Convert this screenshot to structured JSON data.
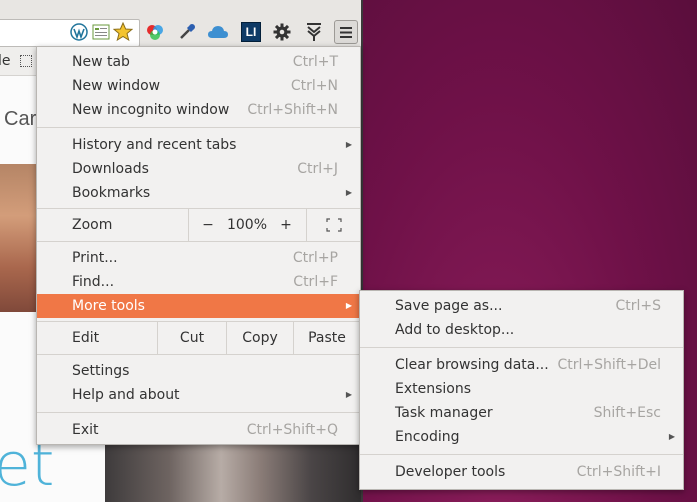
{
  "colors": {
    "menu_highlight": "#f07746",
    "desktop": "#6f1148",
    "shortcut_text": "#a7a5a2"
  },
  "toolbar": {
    "icons": [
      "wordpress-icon",
      "feed-icon",
      "bookmark-star-icon",
      "color-wheel-icon",
      "eyedropper-icon",
      "cloud-icon",
      "linkedin-icon",
      "gear-icon",
      "download-arrows-icon"
    ],
    "linkedin_text": "LI",
    "menu_button": "hamburger-menu-icon"
  },
  "page": {
    "bookmark_fragment": "le",
    "heading_fragment": "Car",
    "large_fragment": "et"
  },
  "main_menu": {
    "new_tab": {
      "label": "New tab",
      "shortcut": "Ctrl+T"
    },
    "new_window": {
      "label": "New window",
      "shortcut": "Ctrl+N"
    },
    "new_incognito": {
      "label": "New incognito window",
      "shortcut": "Ctrl+Shift+N"
    },
    "history": {
      "label": "History and recent tabs"
    },
    "downloads": {
      "label": "Downloads",
      "shortcut": "Ctrl+J"
    },
    "bookmarks": {
      "label": "Bookmarks"
    },
    "zoom": {
      "label": "Zoom",
      "minus": "−",
      "value": "100%",
      "plus": "+"
    },
    "print": {
      "label": "Print...",
      "shortcut": "Ctrl+P"
    },
    "find": {
      "label": "Find...",
      "shortcut": "Ctrl+F"
    },
    "more_tools": {
      "label": "More tools"
    },
    "edit": {
      "label": "Edit",
      "cut": "Cut",
      "copy": "Copy",
      "paste": "Paste"
    },
    "settings": {
      "label": "Settings"
    },
    "help": {
      "label": "Help and about"
    },
    "exit": {
      "label": "Exit",
      "shortcut": "Ctrl+Shift+Q"
    }
  },
  "sub_menu": {
    "save_page": {
      "label": "Save page as...",
      "shortcut": "Ctrl+S"
    },
    "add_desktop": {
      "label": "Add to desktop..."
    },
    "clear_data": {
      "label": "Clear browsing data...",
      "shortcut": "Ctrl+Shift+Del"
    },
    "extensions": {
      "label": "Extensions"
    },
    "task_manager": {
      "label": "Task manager",
      "shortcut": "Shift+Esc"
    },
    "encoding": {
      "label": "Encoding"
    },
    "dev_tools": {
      "label": "Developer tools",
      "shortcut": "Ctrl+Shift+I"
    }
  },
  "arrow_glyph": "▶"
}
